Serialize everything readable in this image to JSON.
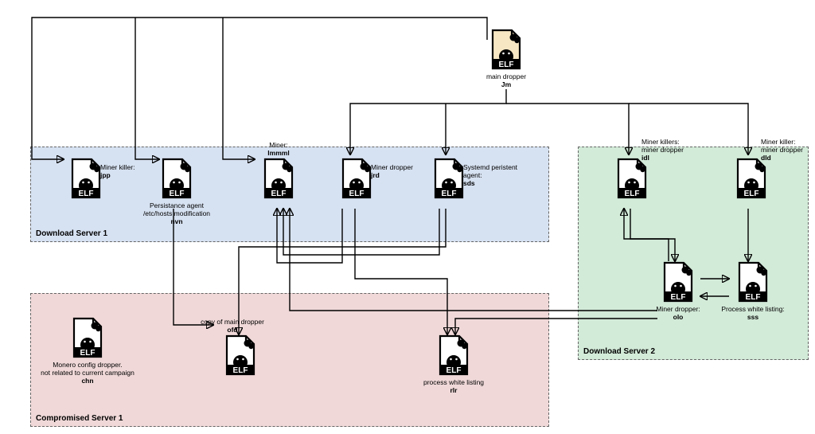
{
  "regions": {
    "blue": {
      "label": "Download Server 1"
    },
    "green": {
      "label": "Download Server 2"
    },
    "pink": {
      "label": "Compromised Server 1"
    }
  },
  "nodes": {
    "jm": {
      "desc": "main dropper",
      "name": "Jm",
      "fill": "#f7e7c3"
    },
    "jpp": {
      "desc": "Miner killer:",
      "name": "jpp",
      "fill": "#fff"
    },
    "nvn": {
      "desc": "Persistance agent\n/etc/hosts modification",
      "name": "nvn",
      "fill": "#fff"
    },
    "lmmml": {
      "desc": "Miner:",
      "name": "lmmml",
      "fill": "#fff"
    },
    "jrd": {
      "desc": "Miner dropper",
      "name": "jrd",
      "fill": "#fff"
    },
    "sds": {
      "desc": "Systemd peristent\nagent:",
      "name": "sds",
      "fill": "#fff"
    },
    "idl": {
      "desc": "Miner killers:\nminer dropper",
      "name": "idl",
      "fill": "#fff"
    },
    "dld": {
      "desc": "Miner killer:\nminer dropper",
      "name": "dld",
      "fill": "#fff"
    },
    "olo": {
      "desc": "Miner dropper:",
      "name": "olo",
      "fill": "#fff"
    },
    "sss": {
      "desc": "Process white listing:",
      "name": "sss",
      "fill": "#fff"
    },
    "chn": {
      "desc": "Monero config dropper.\nnot related to current campaign",
      "name": "chn",
      "fill": "#fff"
    },
    "ofd": {
      "desc": "copy of main dropper",
      "name": "ofd",
      "fill": "#fff"
    },
    "rlr": {
      "desc": "process white listing",
      "name": "rlr",
      "fill": "#fff"
    }
  }
}
